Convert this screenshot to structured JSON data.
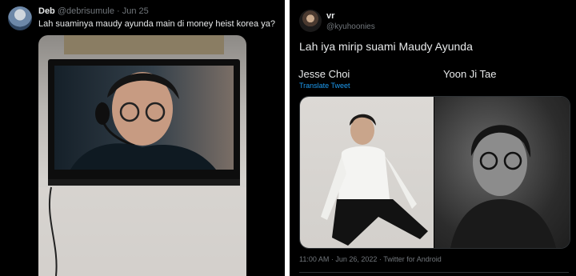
{
  "left_tweet": {
    "display_name": "Deb",
    "handle": "@debrisumule",
    "separator": "·",
    "date": "Jun 25",
    "text": "Lah suaminya maudy ayunda main di money heist korea ya?"
  },
  "right_tweet": {
    "display_name": "vr",
    "handle": "@kyuhoonies",
    "text": "Lah iya mirip suami Maudy Ayunda",
    "caption_left": "Jesse Choi",
    "caption_right": "Yoon Ji Tae",
    "translate_label": "Translate Tweet",
    "meta": "11:00 AM · Jun 26, 2022 · Twitter for Android"
  },
  "colors": {
    "background": "#000000",
    "text_primary": "#e7e9ea",
    "text_muted": "#71767b",
    "link": "#1d9bf0"
  }
}
